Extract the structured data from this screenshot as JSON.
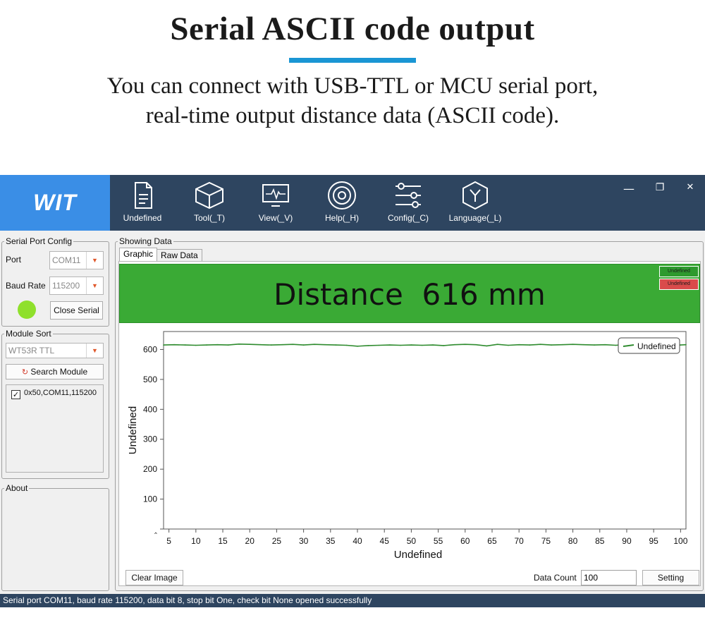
{
  "promo": {
    "title": "Serial ASCII code output",
    "subtitle_line1": "You can connect with USB-TTL or  MCU serial port,",
    "subtitle_line2": "real-time output distance data (ASCII code)."
  },
  "app": {
    "logo": "WIT",
    "toolbar": [
      {
        "label": "Undefined",
        "icon": "document-icon"
      },
      {
        "label": "Tool(_T)",
        "icon": "cube-icon"
      },
      {
        "label": "View(_V)",
        "icon": "waveform-monitor-icon"
      },
      {
        "label": "Help(_H)",
        "icon": "target-icon"
      },
      {
        "label": "Config(_C)",
        "icon": "sliders-icon"
      },
      {
        "label": "Language(_L)",
        "icon": "hexagon-y-icon"
      }
    ],
    "window_controls": {
      "minimize": "—",
      "maximize": "❐",
      "close": "✕"
    }
  },
  "serial_config": {
    "legend": "Serial Port Config",
    "port_label": "Port",
    "port_value": "COM11",
    "baud_label": "Baud Rate",
    "baud_value": "115200",
    "close_button": "Close Serial",
    "status_color": "#8fe02c"
  },
  "module_sort": {
    "legend": "Module Sort",
    "module_value": "WT53R TTL",
    "search_button": "Search Module",
    "modules": [
      {
        "label": "0x50,COM11,115200",
        "checked": true
      }
    ]
  },
  "about": {
    "legend": "About"
  },
  "showing_data": {
    "legend": "Showing Data",
    "tabs": [
      "Graphic",
      "Raw Data"
    ],
    "active_tab": "Graphic",
    "distance_text": "Distance  616 mm",
    "legend_chips": [
      {
        "label": "Undefined",
        "color": "#2e9a2e"
      },
      {
        "label": "Undefined",
        "color": "#d94b4b"
      }
    ],
    "clear_button": "Clear Image",
    "data_count_label": "Data Count",
    "data_count_value": "100",
    "setting_button": "Setting"
  },
  "chart_data": {
    "type": "line",
    "xlabel": "Undefined",
    "ylabel": "Undefined",
    "xlim": [
      4,
      101
    ],
    "ylim": [
      0,
      600
    ],
    "x_ticks": [
      5,
      10,
      15,
      20,
      25,
      30,
      35,
      40,
      45,
      50,
      55,
      60,
      65,
      70,
      75,
      80,
      85,
      90,
      95,
      100
    ],
    "y_ticks": [
      0,
      100,
      200,
      300,
      400,
      500,
      600
    ],
    "y_tick_labels": [
      "‸",
      "100",
      "200",
      "300",
      "400",
      "500",
      "600"
    ],
    "legend_position": "top-right",
    "grid": false,
    "series": [
      {
        "name": "Undefined",
        "color": "#2e8b2e",
        "x": [
          4,
          6,
          8,
          10,
          12,
          14,
          16,
          18,
          20,
          22,
          24,
          26,
          28,
          30,
          32,
          34,
          36,
          38,
          40,
          42,
          44,
          46,
          48,
          50,
          52,
          54,
          56,
          58,
          60,
          62,
          64,
          66,
          68,
          70,
          72,
          74,
          76,
          78,
          80,
          82,
          84,
          86,
          88,
          90,
          92,
          94,
          96,
          98,
          100,
          101
        ],
        "values": [
          615,
          616,
          615,
          614,
          615,
          616,
          615,
          618,
          617,
          616,
          615,
          616,
          617,
          615,
          617,
          616,
          615,
          614,
          611,
          613,
          614,
          615,
          614,
          615,
          614,
          615,
          613,
          616,
          617,
          616,
          612,
          617,
          614,
          616,
          615,
          617,
          615,
          616,
          617,
          616,
          615,
          616,
          614,
          617,
          613,
          615,
          616,
          614,
          615,
          616
        ]
      }
    ]
  },
  "status_bar": {
    "text": "Serial port COM11, baud rate 115200, data bit 8, stop bit One, check bit None opened successfully"
  }
}
